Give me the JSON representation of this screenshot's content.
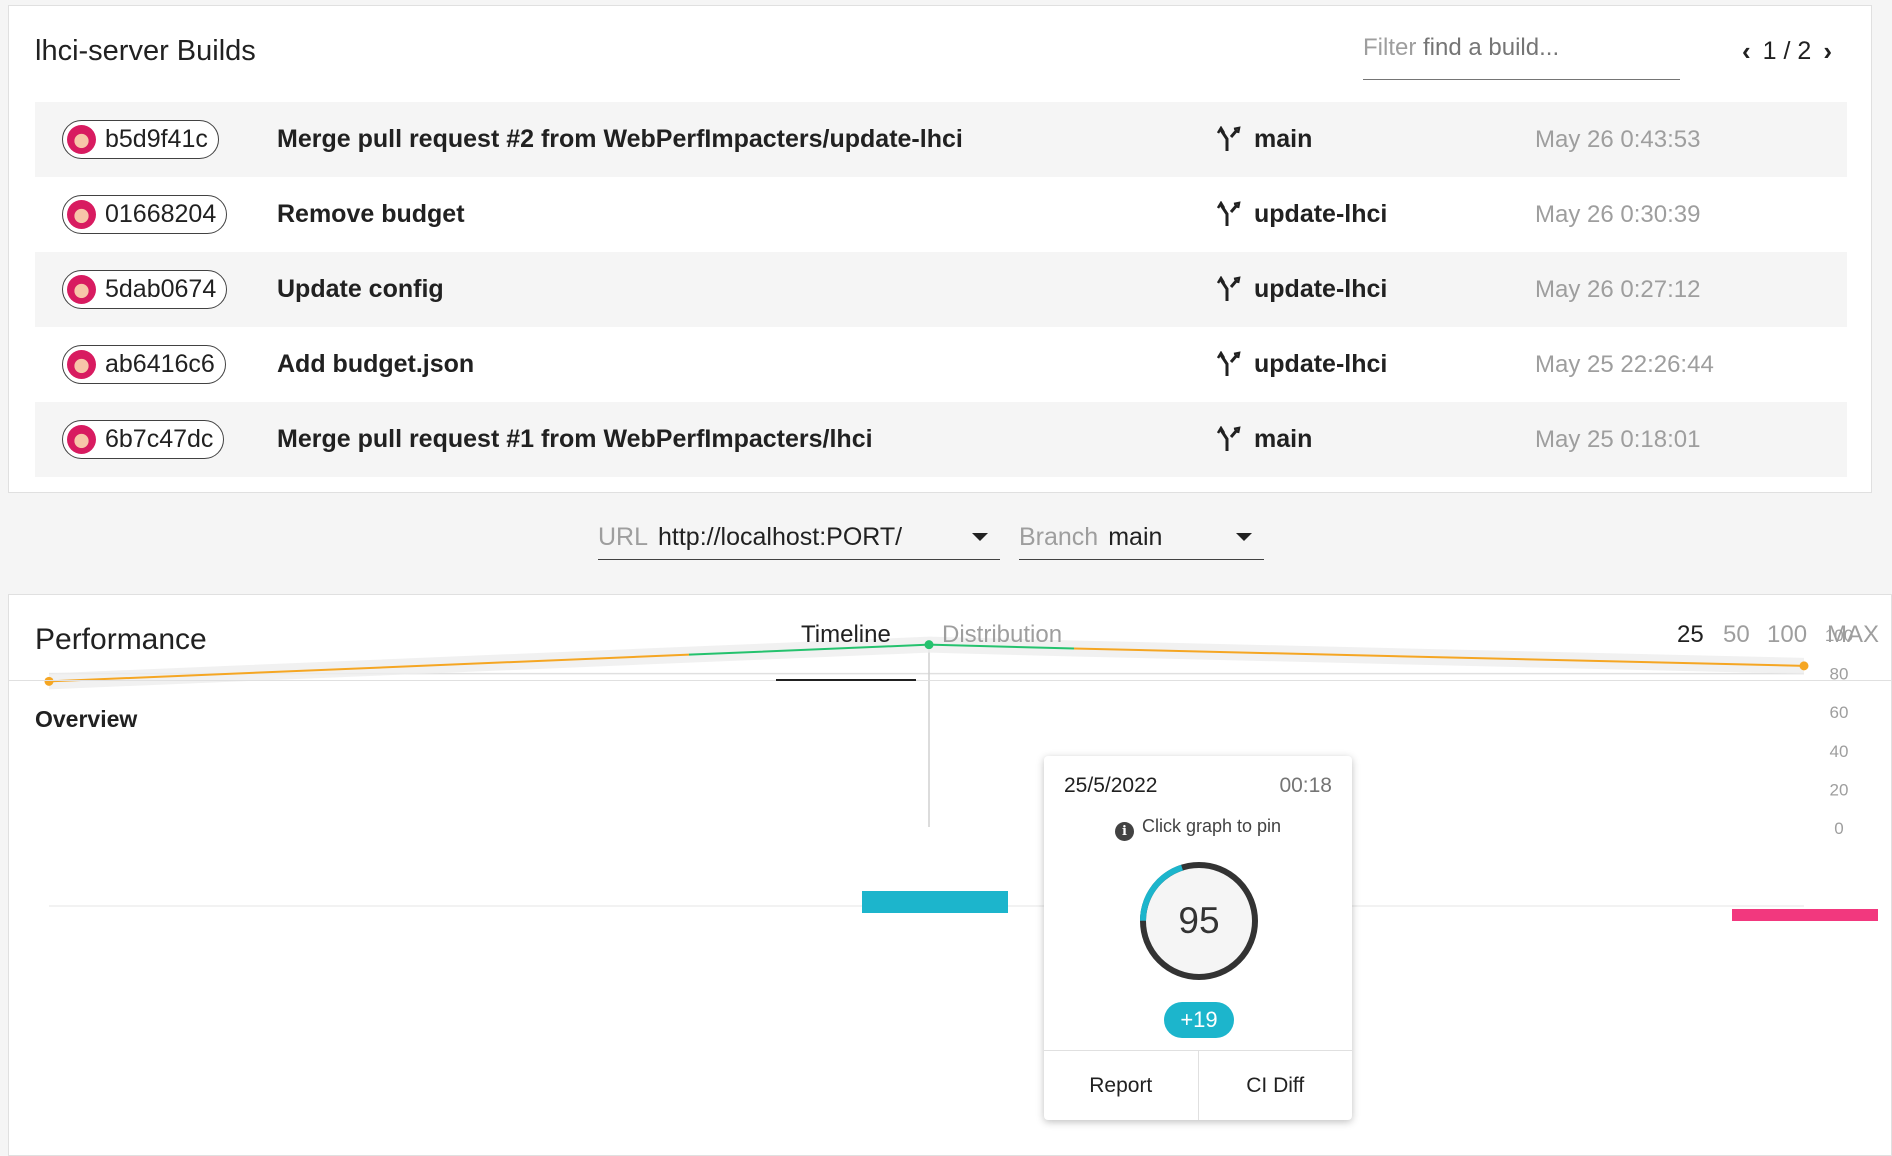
{
  "builds": {
    "title": "lhci-server Builds",
    "filter": {
      "label": "Filter",
      "placeholder": "find a build..."
    },
    "pagination": "1 / 2",
    "rows": [
      {
        "hash": "b5d9f41c",
        "message": "Merge pull request #2 from WebPerfImpacters/update-lhci",
        "branch": "main",
        "time": "May 26 0:43:53"
      },
      {
        "hash": "01668204",
        "message": "Remove budget",
        "branch": "update-lhci",
        "time": "May 26 0:30:39"
      },
      {
        "hash": "5dab0674",
        "message": "Update config",
        "branch": "update-lhci",
        "time": "May 26 0:27:12"
      },
      {
        "hash": "ab6416c6",
        "message": "Add budget.json",
        "branch": "update-lhci",
        "time": "May 25 22:26:44"
      },
      {
        "hash": "6b7c47dc",
        "message": "Merge pull request #1 from WebPerfImpacters/lhci",
        "branch": "main",
        "time": "May 25 0:18:01"
      }
    ]
  },
  "selectors": {
    "url": {
      "label": "URL",
      "value": "http://localhost:PORT/"
    },
    "branch": {
      "label": "Branch",
      "value": "main"
    }
  },
  "performance": {
    "title": "Performance",
    "tabs": [
      "Timeline",
      "Distribution"
    ],
    "active_tab": "Timeline",
    "limits": [
      "25",
      "50",
      "100",
      "MAX"
    ],
    "active_limit": "25",
    "overview_label": "Overview"
  },
  "chart_data": {
    "type": "line",
    "y_ticks": [
      "100",
      "80",
      "60",
      "40",
      "20",
      "0"
    ],
    "ylim": [
      0,
      100
    ],
    "series": [
      {
        "values": [
          76,
          95,
          93,
          84
        ]
      }
    ],
    "bars": [
      {
        "color": "#1cb5cc"
      },
      {
        "color": "#f2387e"
      }
    ]
  },
  "tooltip": {
    "date": "25/5/2022",
    "time": "00:18",
    "hint": "Click graph to pin",
    "score": "95",
    "score_fraction": 0.95,
    "delta": "+19",
    "actions": [
      "Report",
      "CI Diff"
    ]
  },
  "colors": {
    "good": "#25c26e",
    "average": "#f5a623",
    "accent": "#1cb5cc",
    "bad": "#f2387e"
  }
}
